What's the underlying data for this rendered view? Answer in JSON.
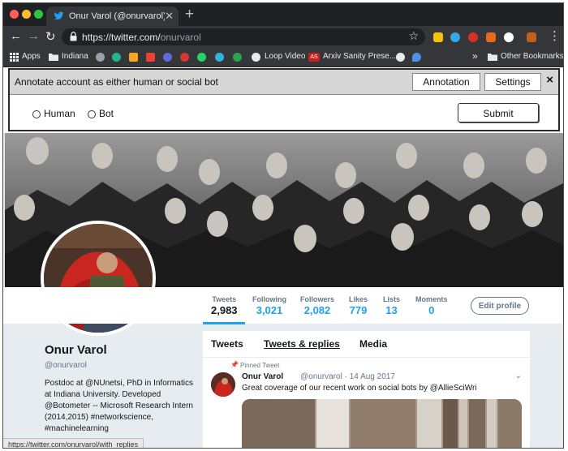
{
  "browser": {
    "tab_title": "Onur Varol (@onurvarol) | Twitt",
    "url_host": "https://twitter.com/",
    "url_path": "onurvarol",
    "status_url": "https://twitter.com/onurvarol/with_replies"
  },
  "bookmarks": {
    "apps": "Apps",
    "indiana": "Indiana",
    "loop_video": "Loop Video",
    "arxiv": "Arxiv Sanity Prese...",
    "arxiv_badge": "AS",
    "overflow": "»",
    "other": "Other Bookmarks"
  },
  "annotation": {
    "title": "Annotate account as either human or social bot",
    "annotation_tab": "Annotation",
    "settings_tab": "Settings",
    "close": "×",
    "option_human": "Human",
    "option_bot": "Bot",
    "submit": "Submit"
  },
  "profile": {
    "stats": [
      {
        "label": "Tweets",
        "value": "2,983"
      },
      {
        "label": "Following",
        "value": "3,021"
      },
      {
        "label": "Followers",
        "value": "2,082"
      },
      {
        "label": "Likes",
        "value": "779"
      },
      {
        "label": "Lists",
        "value": "13"
      },
      {
        "label": "Moments",
        "value": "0"
      }
    ],
    "edit_profile": "Edit profile",
    "name": "Onur Varol",
    "handle": "@onurvarol",
    "bio": "Postdoc at @NUnetsi, PhD in Informatics at Indiana University. Developed @Botometer -- Microsoft Research Intern (2014,2015) #networkscience, #machinelearning"
  },
  "timeline": {
    "tabs": [
      "Tweets",
      "Tweets & replies",
      "Media"
    ],
    "pinned_label": "Pinned Tweet",
    "tweet": {
      "name": "Onur Varol",
      "handle_date": "@onurvarol · 14 Aug 2017",
      "text": "Great coverage of our recent work on social bots by @AllieSciWri"
    }
  },
  "colors": {
    "twitter_blue": "#1da1f2",
    "chrome_dark": "#35363a",
    "annotation_bar": "#d6d6d6"
  }
}
